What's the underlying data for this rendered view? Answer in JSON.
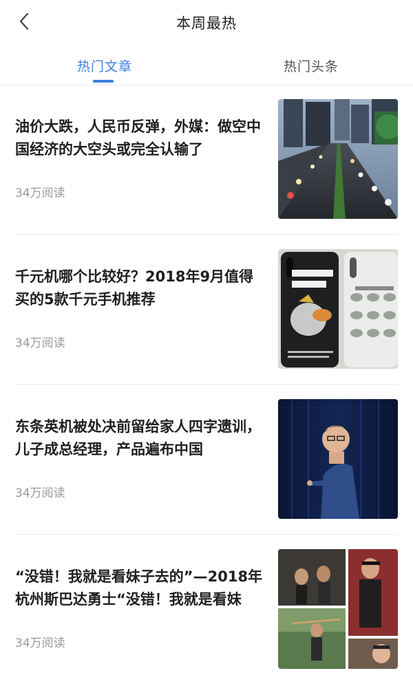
{
  "header": {
    "title": "本周最热",
    "back_icon": "chevron-left-icon",
    "tabs": [
      {
        "label": "热门文章",
        "active": true
      },
      {
        "label": "热门头条",
        "active": false
      }
    ],
    "accent_color": "#3c7de0"
  },
  "articles": [
    {
      "title": "油价大跌，人民币反弹，外媒：做空中国经济的大空头或完全认输了",
      "reads": "34万阅读",
      "thumbnail": "city-traffic-photo"
    },
    {
      "title": "千元机哪个比较好？2018年9月值得买的5款千元手机推荐",
      "reads": "34万阅读",
      "thumbnail": "phone-cases-photo"
    },
    {
      "title": "东条英机被处决前留给家人四字遗训，儿子成总经理，产品遍布中国",
      "reads": "34万阅读",
      "thumbnail": "speaker-on-stage-photo"
    },
    {
      "title": "“没错！我就是看妹子去的”—2018年杭州斯巴达勇士“没错！我就是看妹",
      "reads": "34万阅读",
      "thumbnail": "spartan-race-collage-photo"
    }
  ]
}
